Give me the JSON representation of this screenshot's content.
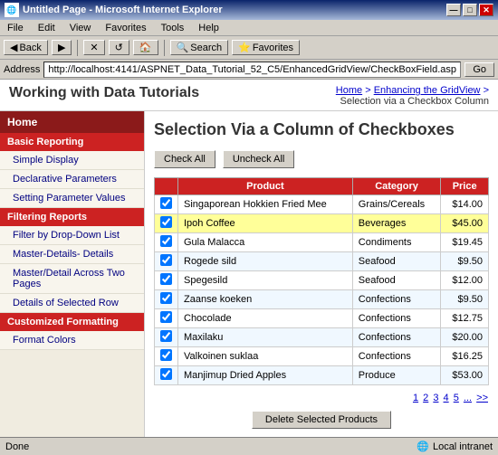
{
  "window": {
    "title": "Untitled Page - Microsoft Internet Explorer",
    "icon": "🌐"
  },
  "titlebar_buttons": [
    "—",
    "□",
    "✕"
  ],
  "menubar": {
    "items": [
      "File",
      "Edit",
      "View",
      "Favorites",
      "Tools",
      "Help"
    ]
  },
  "toolbar": {
    "back_label": "Back",
    "forward_label": "▶",
    "stop_label": "✕",
    "refresh_label": "↺",
    "home_label": "🏠",
    "search_label": "Search",
    "favorites_label": "Favorites"
  },
  "addressbar": {
    "label": "Address",
    "url": "http://localhost:4141/ASPNET_Data_Tutorial_52_C5/EnhancedGridView/CheckBoxField.aspx",
    "go_label": "Go"
  },
  "header": {
    "site_title": "Working with Data Tutorials",
    "breadcrumb_home": "Home",
    "breadcrumb_section": "Enhancing the GridView",
    "breadcrumb_current": "Selection via a Checkbox Column"
  },
  "sidebar": {
    "home_label": "Home",
    "sections": [
      {
        "title": "Basic Reporting",
        "items": [
          "Simple Display",
          "Declarative Parameters",
          "Setting Parameter Values"
        ]
      },
      {
        "title": "Filtering Reports",
        "items": [
          "Filter by Drop-Down List",
          "Master-Details- Details",
          "Master/Detail Across Two Pages",
          "Details of Selected Row"
        ]
      },
      {
        "title": "Customized Formatting",
        "items": [
          "Format Colors"
        ]
      }
    ]
  },
  "main": {
    "heading": "Selection Via a Column of Checkboxes",
    "check_all_label": "Check All",
    "uncheck_all_label": "Uncheck All",
    "table": {
      "columns": [
        "Product",
        "Category",
        "Price"
      ],
      "rows": [
        {
          "checked": true,
          "product": "Singaporean Hokkien Fried Mee",
          "category": "Grains/Cereals",
          "price": "$14.00"
        },
        {
          "checked": true,
          "product": "Ipoh Coffee",
          "category": "Beverages",
          "price": "$45.00",
          "highlighted": true
        },
        {
          "checked": true,
          "product": "Gula Malacca",
          "category": "Condiments",
          "price": "$19.45"
        },
        {
          "checked": true,
          "product": "Rogede sild",
          "category": "Seafood",
          "price": "$9.50"
        },
        {
          "checked": true,
          "product": "Spegesild",
          "category": "Seafood",
          "price": "$12.00"
        },
        {
          "checked": true,
          "product": "Zaanse koeken",
          "category": "Confections",
          "price": "$9.50"
        },
        {
          "checked": true,
          "product": "Chocolade",
          "category": "Confections",
          "price": "$12.75"
        },
        {
          "checked": true,
          "product": "Maxilaku",
          "category": "Confections",
          "price": "$20.00"
        },
        {
          "checked": true,
          "product": "Valkoinen suklaa",
          "category": "Confections",
          "price": "$16.25"
        },
        {
          "checked": true,
          "product": "Manjimup Dried Apples",
          "category": "Produce",
          "price": "$53.00"
        }
      ]
    },
    "pagination": {
      "pages": [
        "1",
        "2",
        "3",
        "4",
        "5",
        "...",
        ">>"
      ],
      "current": "1"
    },
    "delete_button_label": "Delete Selected Products"
  },
  "statusbar": {
    "status": "Done",
    "zone": "Local intranet"
  }
}
